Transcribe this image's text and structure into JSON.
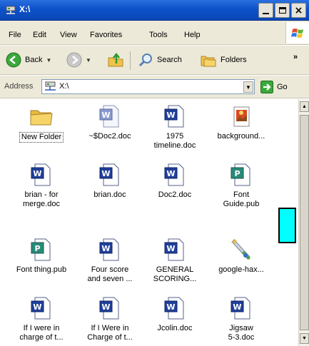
{
  "window": {
    "title": "X:\\",
    "title_icon": "network-drive-icon"
  },
  "menu": {
    "items": [
      "File",
      "Edit",
      "View",
      "Favorites",
      "Tools",
      "Help"
    ]
  },
  "toolbar": {
    "back_label": "Back",
    "search_label": "Search",
    "folders_label": "Folders",
    "more": "»"
  },
  "address": {
    "label": "Address",
    "value": "X:\\",
    "go_label": "Go"
  },
  "files": [
    {
      "name": "New Folder",
      "type": "folder"
    },
    {
      "name": "~$Doc2.doc",
      "type": "word-temp"
    },
    {
      "name": "1975\ntimeline.doc",
      "type": "word"
    },
    {
      "name": "background...",
      "type": "image"
    },
    {
      "name": "brian - for\nmerge.doc",
      "type": "word"
    },
    {
      "name": "brian.doc",
      "type": "word"
    },
    {
      "name": "Doc2.doc",
      "type": "word"
    },
    {
      "name": "Font\nGuide.pub",
      "type": "publisher"
    },
    {
      "name": "Font thing.pub",
      "type": "publisher"
    },
    {
      "name": "Four score\nand seven ...",
      "type": "word"
    },
    {
      "name": "GENERAL\nSCORING...",
      "type": "word"
    },
    {
      "name": "google-hax...",
      "type": "script"
    },
    {
      "name": "If I were in\ncharge of t...",
      "type": "word"
    },
    {
      "name": "If I Were in\nCharge of t...",
      "type": "word"
    },
    {
      "name": "Jcolin.doc",
      "type": "word"
    },
    {
      "name": "Jigsaw\n5-3.doc",
      "type": "word"
    }
  ],
  "colors": {
    "titlebar": "#0a47b6",
    "marker": "#00ffff",
    "word_blue": "#1f3f99",
    "publisher_teal": "#2a8a7a",
    "folder_yellow": "#f5d35e"
  }
}
